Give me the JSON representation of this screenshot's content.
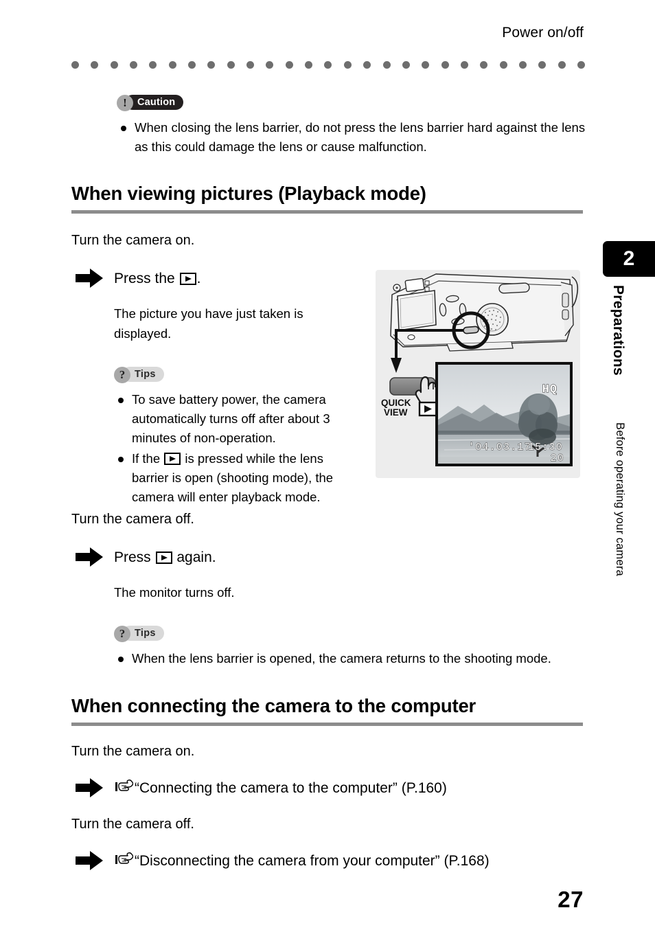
{
  "header": {
    "running_head": "Power on/off"
  },
  "caution": {
    "badge_label": "Caution",
    "badge_icon": "exclamation-icon",
    "items": [
      "When closing the lens barrier, do not press the lens barrier hard against the lens as this could damage the lens or cause malfunction."
    ]
  },
  "section_playback": {
    "heading": "When viewing pictures (Playback mode)",
    "lead_on": "Turn the camera on.",
    "step_on_prefix": "Press the",
    "step_on_suffix": ".",
    "step_on_desc": "The picture you have just taken is displayed.",
    "tips_on": {
      "badge_label": "Tips",
      "badge_icon": "question-icon",
      "items": [
        "To save battery power, the camera automatically turns off after about 3 minutes of non-operation.",
        "If the ▶ is pressed while the lens barrier is open (shooting mode), the camera will enter playback mode."
      ],
      "item2_prefix": "If the",
      "item2_suffix": "is pressed while the lens barrier is open (shooting mode), the camera will enter playback mode."
    },
    "lead_off": "Turn the camera off.",
    "step_off_prefix": "Press",
    "step_off_suffix": "again.",
    "step_off_desc": "The monitor turns off.",
    "tips_off": {
      "badge_label": "Tips",
      "badge_icon": "question-icon",
      "items": [
        "When the lens barrier is opened, the camera returns to the shooting mode."
      ]
    }
  },
  "illustration": {
    "name": "camera-back-quick-view-illustration",
    "button_label_line1": "QUICK",
    "button_label_line2": "VIEW",
    "lcd": {
      "quality_indicator": "HQ",
      "date": "′04.03.17",
      "time": "15:30",
      "frame_number": "20"
    }
  },
  "section_computer": {
    "heading": "When connecting the camera to the computer",
    "lead_on": "Turn the camera on.",
    "xref_on": "“Connecting the camera to the computer” (P.160)",
    "lead_off": "Turn the camera off.",
    "xref_off": "“Disconnecting the camera from your computer” (P.168)"
  },
  "sidebar": {
    "chapter_number": "2",
    "chapter_title": "Preparations",
    "chapter_subtitle": "Before operating your camera"
  },
  "footer": {
    "page_number": "27"
  },
  "colors": {
    "rule_gray": "#8c8c8c",
    "dot_gray": "#6e6e6e",
    "illustration_bg": "#ededed",
    "caution_pill": "#231f20",
    "tips_pill": "#d9d9d9"
  }
}
